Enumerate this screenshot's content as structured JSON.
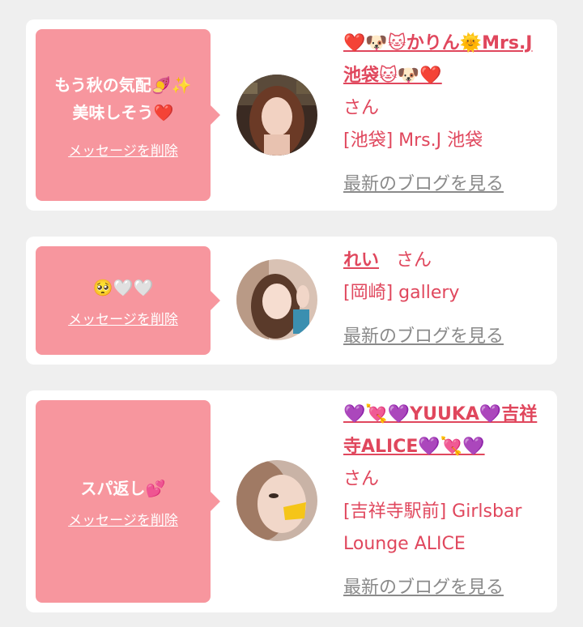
{
  "cards": [
    {
      "message_line1": "もう秋の気配🍠✨",
      "message_line2": "美味しそう❤️",
      "delete_label": "メッセージを削除",
      "name": "❤️🐶🐱かりん🌞Mrs.J池袋🐱🐶❤️",
      "san": "さん",
      "shop": "[池袋] Mrs.J 池袋",
      "blog_link": "最新のブログを見る"
    },
    {
      "message_line1": "🥺🤍🤍",
      "message_line2": "",
      "delete_label": "メッセージを削除",
      "name": "れい",
      "san": "さん",
      "shop": "[岡崎] gallery",
      "blog_link": "最新のブログを見る"
    },
    {
      "message_line1": "スパ返し💕",
      "message_line2": "",
      "delete_label": "メッセージを削除",
      "name": "💜💘💜YUUKA💜吉祥寺ALICE💜💘💜",
      "san": "さん",
      "shop": "[吉祥寺駅前] Girlsbar Lounge ALICE",
      "blog_link": "最新のブログを見る"
    }
  ],
  "colors": {
    "bubble": "#f7969e",
    "accent": "#e0475d",
    "link_gray": "#8a8a8a",
    "page_bg": "#efefef"
  }
}
